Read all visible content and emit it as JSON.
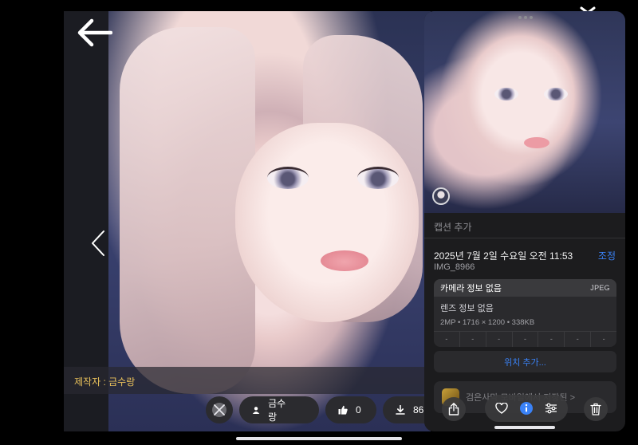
{
  "viewer": {
    "author_caption": "제작자 : 금수랑",
    "author_name": "금수랑",
    "likes": "0",
    "downloads": "86"
  },
  "info_sheet": {
    "caption_placeholder": "캡션 추가",
    "datetime": "2025년 7월 2일 수요일 오전 11:53",
    "adjust_label": "조정",
    "filename": "IMG_8966",
    "camera_title": "카메라 정보 없음",
    "format_badge": "JPEG",
    "lens_info": "렌즈 정보 없음",
    "specs": "2MP • 1716 × 1200 • 338KB",
    "exif_values": [
      "-",
      "-",
      "-",
      "-",
      "-",
      "-",
      "-"
    ],
    "location_button": "위치 추가...",
    "source_app": "검은사막 모바일에서 저장된 >"
  },
  "colors": {
    "accent_blue": "#3a82f7",
    "author_gold": "#e9c15b",
    "sheet_bg": "#1c1c1e"
  },
  "icons": [
    "back-arrow-icon",
    "chevron-left-icon",
    "crossed-swords-icon",
    "user-icon",
    "thumbs-up-icon",
    "download-icon",
    "share-icon",
    "heart-icon",
    "info-icon",
    "sliders-icon",
    "trash-icon",
    "close-icon"
  ]
}
